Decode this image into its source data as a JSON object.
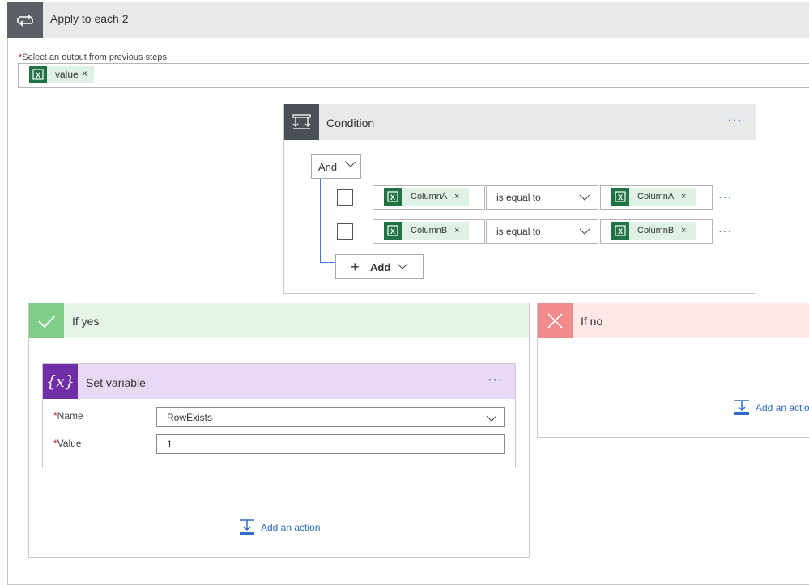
{
  "apply_each": {
    "title": "Apply to each 2",
    "select_label": "Select an output from previous steps",
    "required_marker": "*",
    "token": {
      "label": "value",
      "remove": "×",
      "icon": "excel-icon"
    }
  },
  "condition": {
    "title": "Condition",
    "more": "···",
    "group_operator": "And",
    "rows": [
      {
        "left_token": "ColumnA",
        "operator": "is equal to",
        "right_token": "ColumnA",
        "remove": "×",
        "more": "···"
      },
      {
        "left_token": "ColumnB",
        "operator": "is equal to",
        "right_token": "ColumnB",
        "remove": "×",
        "more": "···"
      }
    ],
    "add_label": "Add",
    "add_symbol": "+"
  },
  "if_yes": {
    "title": "If yes",
    "set_variable": {
      "title": "Set variable",
      "icon_text": "{x}",
      "more": "···",
      "name_label": "Name",
      "name_value": "RowExists",
      "value_label": "Value",
      "value_value": "1",
      "required_marker": "*"
    },
    "add_action_label": "Add an action"
  },
  "if_no": {
    "title": "If no",
    "add_action_label": "Add an action"
  },
  "colors": {
    "accent": "#3a7bd5",
    "excel_green": "#217346",
    "yes_green": "#7fcf8a",
    "no_red": "#f28b8b",
    "variable_purple": "#6f2da8"
  }
}
